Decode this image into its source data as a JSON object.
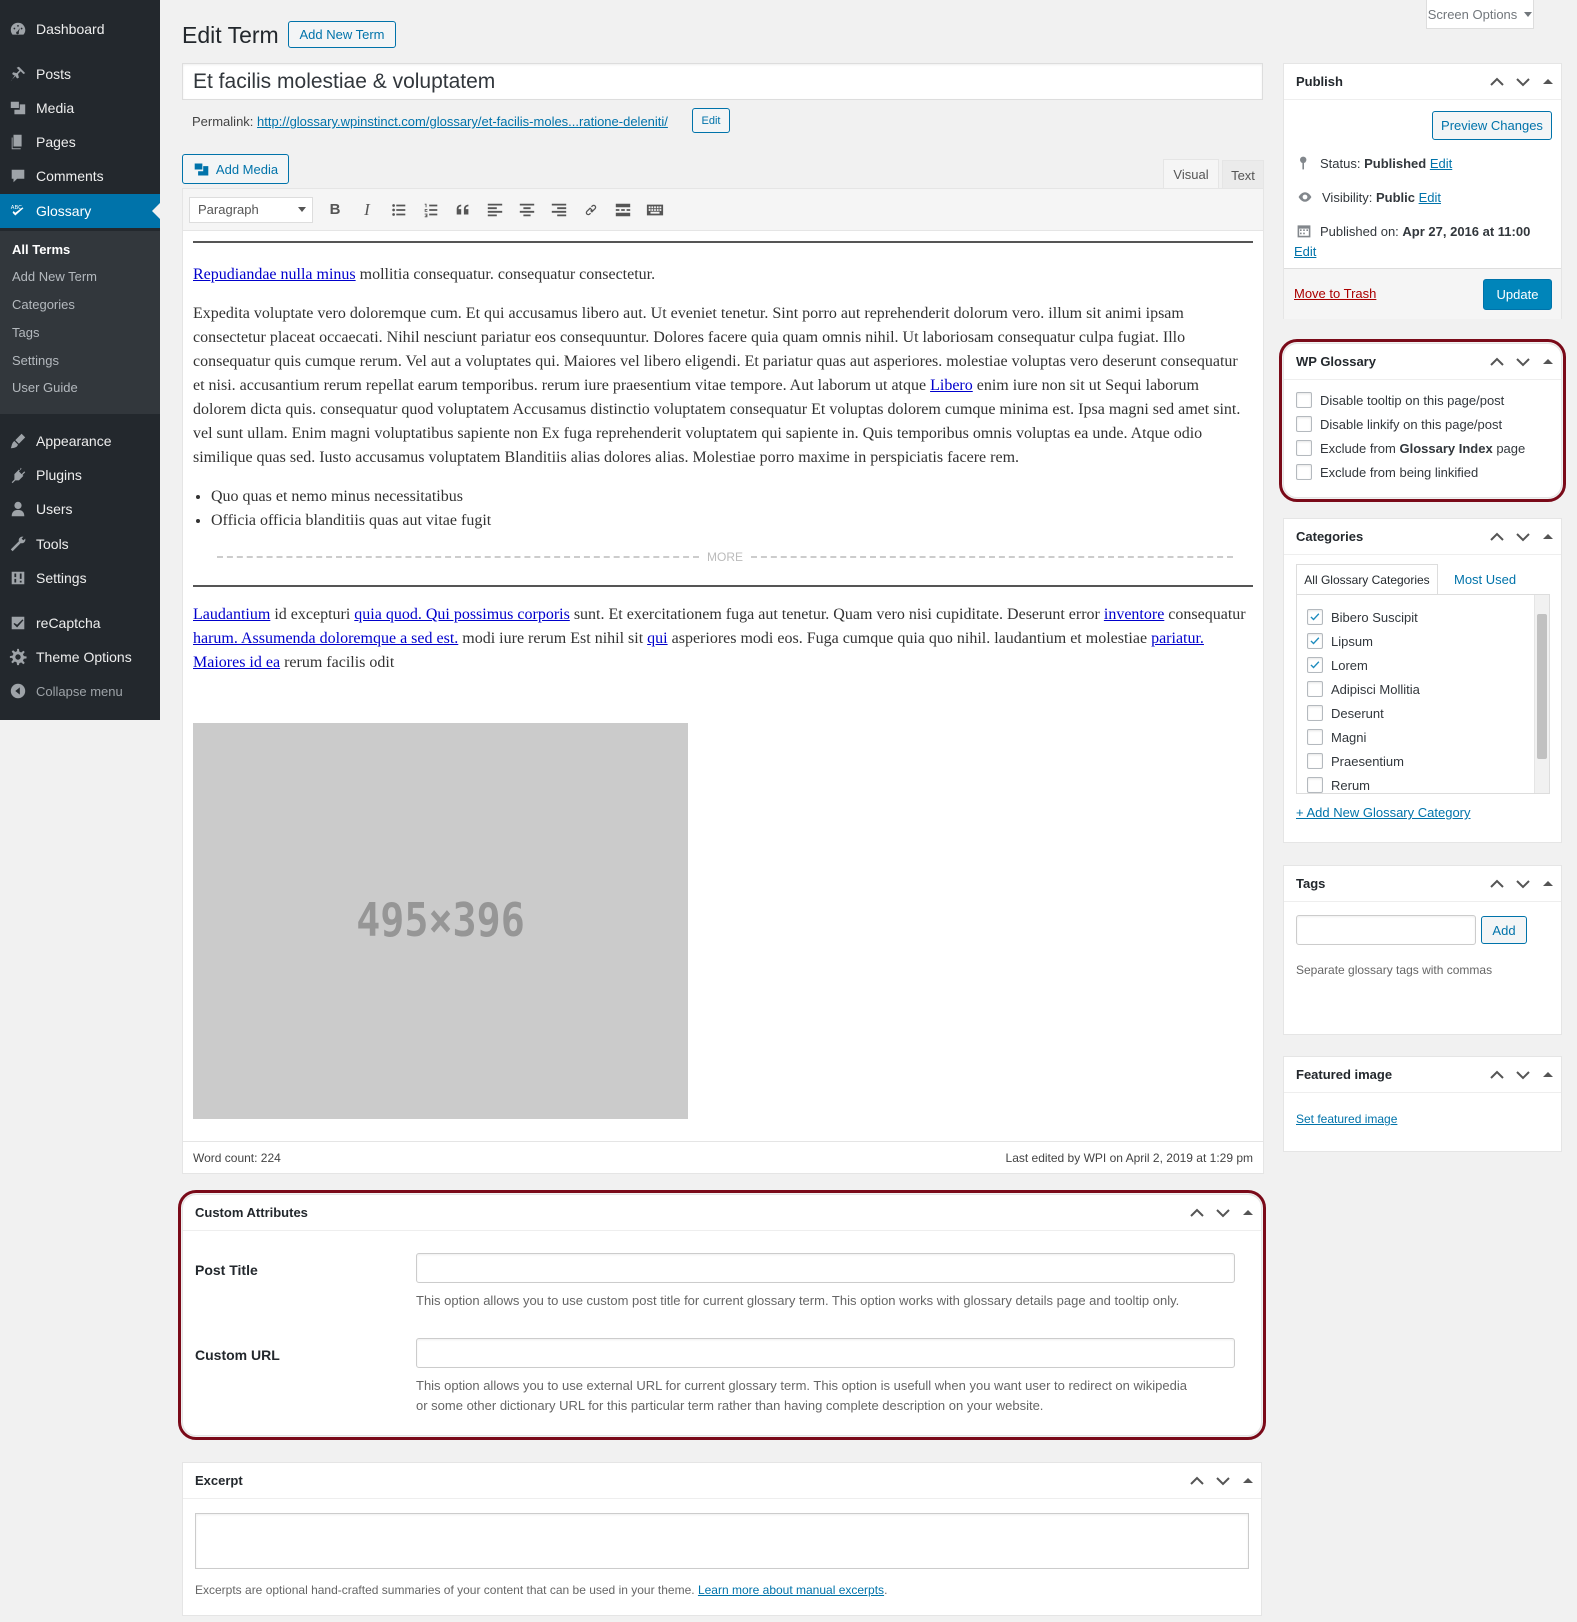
{
  "sidebar": {
    "items": [
      {
        "label": "Dashboard",
        "icon": "dashboard-icon"
      },
      {
        "label": "Posts",
        "icon": "pin-icon"
      },
      {
        "label": "Media",
        "icon": "media-icon"
      },
      {
        "label": "Pages",
        "icon": "pages-icon"
      },
      {
        "label": "Comments",
        "icon": "comments-icon"
      },
      {
        "label": "Glossary",
        "icon": "glossary-icon"
      },
      {
        "label": "Appearance",
        "icon": "brush-icon"
      },
      {
        "label": "Plugins",
        "icon": "plugin-icon"
      },
      {
        "label": "Users",
        "icon": "users-icon"
      },
      {
        "label": "Tools",
        "icon": "wrench-icon"
      },
      {
        "label": "Settings",
        "icon": "settings-icon"
      },
      {
        "label": "reCaptcha",
        "icon": "checkbox-icon"
      },
      {
        "label": "Theme Options",
        "icon": "gear-icon"
      },
      {
        "label": "Collapse menu",
        "icon": "collapse-icon"
      }
    ],
    "submenu": [
      "All Terms",
      "Add New Term",
      "Categories",
      "Tags",
      "Settings",
      "User Guide"
    ]
  },
  "header": {
    "screen_options": "Screen Options",
    "title": "Edit Term",
    "add_new": "Add New Term"
  },
  "post": {
    "title": "Et facilis molestiae & voluptatem",
    "permalink_label": "Permalink:",
    "permalink_url": "http://glossary.wpinstinct.com/glossary/et-facilis-moles...ratione-deleniti/",
    "permalink_edit": "Edit"
  },
  "editor": {
    "add_media": "Add Media",
    "tab_visual": "Visual",
    "tab_text": "Text",
    "format": "Paragraph",
    "para1_link": "Repudiandae nulla minus",
    "para1_rest": " mollitia consequatur. consequatur consectetur.",
    "para2_a": "Expedita voluptate vero doloremque cum. Et qui accusamus libero aut. Ut eveniet tenetur. Sint porro aut reprehenderit dolorum vero. illum sit animi ipsam consectetur placeat occaecati. Nihil nesciunt pariatur eos consequuntur. Dolores facere quia quam omnis nihil. Ut laboriosam consequatur culpa fugiat. Illo consequatur quis cumque rerum. Vel aut a voluptates qui. Maiores vel libero eligendi. Et pariatur quas aut asperiores. molestiae voluptas vero deserunt consequatur et nisi. accusantium rerum repellat earum temporibus. rerum iure praesentium vitae tempore. Aut laborum ut atque ",
    "para2_link": "Libero",
    "para2_b": " enim iure non sit ut Sequi laborum dolorem dicta quis. consequatur quod voluptatem Accusamus distinctio voluptatem consequatur Et voluptas dolorem cumque minima est. Ipsa magni sed amet sint. vel sunt ullam. Enim magni voluptatibus sapiente non Ex fuga reprehenderit voluptatem qui sapiente in. Quis temporibus omnis voluptas ea unde. Atque odio similique quas sed. Iusto accusamus voluptatem Blanditiis alias dolores alias. Molestiae porro maxime in perspiciatis facere rem.",
    "list": [
      "Quo quas et nemo minus necessitatibus",
      "Officia officia blanditiis quas aut vitae fugit"
    ],
    "more": "MORE",
    "p3": {
      "l1": "Laudantium",
      "t1": " id excepturi ",
      "l2": "quia quod. Qui possimus corporis",
      "t2": " sunt. Et exercitationem fuga aut tenetur. Quam vero nisi cupiditate. Deserunt error ",
      "l3": "inventore",
      "t3": " consequatur ",
      "l4": "harum. Assumenda doloremque a sed est.",
      "t4": " modi iure rerum Est nihil sit ",
      "l5": "qui",
      "t5": " asperiores modi eos. Fuga cumque quia quo nihil. laudantium et molestiae ",
      "l6": "pariatur. Maiores id ea",
      "t6": " rerum facilis odit"
    },
    "image_label": "495×396",
    "word_count": "Word count: 224",
    "last_edited": "Last edited by WPI on April 2, 2019 at 1:29 pm"
  },
  "custom_attributes": {
    "title": "Custom Attributes",
    "post_title_label": "Post Title",
    "post_title_value": "",
    "post_title_desc": "This option allows you to use custom post title for current glossary term. This option works with glossary details page and tooltip only.",
    "custom_url_label": "Custom URL",
    "custom_url_value": "",
    "custom_url_desc1": "This option allows you to use external URL for current glossary term. This option is usefull when you want user to redirect on wikipedia",
    "custom_url_desc2": "or some other dictionary URL for this particular term rather than having complete description on your website."
  },
  "excerpt": {
    "title": "Excerpt",
    "value": "",
    "desc": "Excerpts are optional hand-crafted summaries of your content that can be used in your theme. ",
    "link": "Learn more about manual excerpts",
    "end": "."
  },
  "publish": {
    "title": "Publish",
    "preview": "Preview Changes",
    "status_label": "Status:",
    "status_value": "Published",
    "visibility_label": "Visibility:",
    "visibility_value": "Public",
    "published_label": "Published on:",
    "published_value": "Apr 27, 2016 at 11:00",
    "edit": "Edit",
    "trash": "Move to Trash",
    "update": "Update"
  },
  "wp_glossary": {
    "title": "WP Glossary",
    "options": [
      {
        "pre": "Disable tooltip on this page/post",
        "bold": "",
        "post": "",
        "checked": false
      },
      {
        "pre": "Disable linkify on this page/post",
        "bold": "",
        "post": "",
        "checked": false
      },
      {
        "pre": "Exclude from ",
        "bold": "Glossary Index",
        "post": " page",
        "checked": false
      },
      {
        "pre": "Exclude from being linkified",
        "bold": "",
        "post": "",
        "checked": false
      }
    ]
  },
  "categories": {
    "title": "Categories",
    "tab_all": "All Glossary Categories",
    "tab_most": "Most Used",
    "items": [
      {
        "label": "Bibero Suscipit",
        "checked": true
      },
      {
        "label": "Lipsum",
        "checked": true
      },
      {
        "label": "Lorem",
        "checked": true
      },
      {
        "label": "Adipisci Mollitia",
        "checked": false
      },
      {
        "label": "Deserunt",
        "checked": false
      },
      {
        "label": "Magni",
        "checked": false
      },
      {
        "label": "Praesentium",
        "checked": false
      },
      {
        "label": "Rerum",
        "checked": false
      }
    ],
    "add_new": "+ Add New Glossary Category"
  },
  "tags": {
    "title": "Tags",
    "input": "",
    "add": "Add",
    "hint": "Separate glossary tags with commas"
  },
  "featured_image": {
    "title": "Featured image",
    "link": "Set featured image"
  },
  "colors": {
    "sidebar_bg": "#23282d",
    "accent": "#0073aa",
    "highlight": "#7a0a19"
  }
}
